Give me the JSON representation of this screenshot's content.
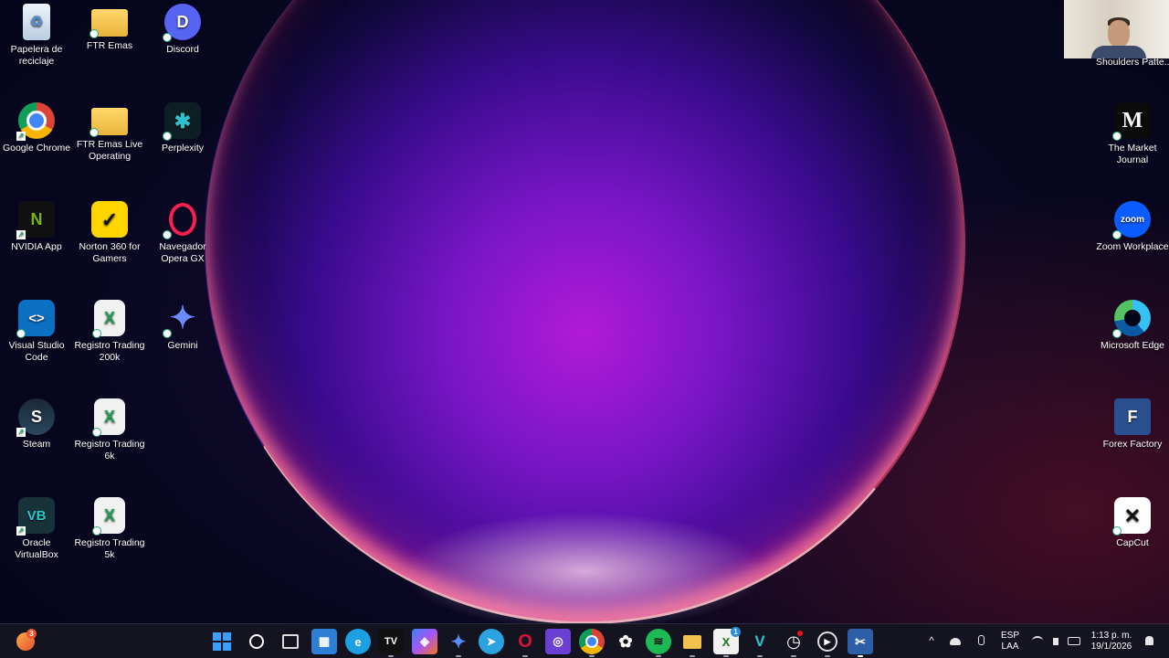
{
  "desktop": {
    "icons": [
      {
        "label": "Papelera de reciclaje",
        "icon": "recycle-bin-icon",
        "color": "#dfe9f5"
      },
      {
        "label": "FTR Emas",
        "icon": "folder-icon",
        "color": "#f2c14e"
      },
      {
        "label": "Discord",
        "icon": "discord-icon",
        "color": "#5865f2"
      },
      {
        "label": "Google Chrome",
        "icon": "chrome-icon",
        "color": "#4285f4"
      },
      {
        "label": "FTR Emas Live Operating",
        "icon": "folder-icon",
        "color": "#f2c14e"
      },
      {
        "label": "Perplexity",
        "icon": "perplexity-icon",
        "color": "#20808d"
      },
      {
        "label": "NVIDIA App",
        "icon": "nvidia-icon",
        "color": "#76b900"
      },
      {
        "label": "Norton 360 for Gamers",
        "icon": "norton-icon",
        "color": "#ffd500"
      },
      {
        "label": "Navegador Opera GX",
        "icon": "opera-gx-icon",
        "color": "#fa1e4e"
      },
      {
        "label": "Visual Studio Code",
        "icon": "vscode-icon",
        "color": "#2c8fe0"
      },
      {
        "label": "Registro Trading 200k",
        "icon": "excel-file-icon",
        "color": "#1f9d55"
      },
      {
        "label": "Gemini",
        "icon": "gemini-icon",
        "color": "#6a8cff"
      },
      {
        "label": "Steam",
        "icon": "steam-icon",
        "color": "#1b2838"
      },
      {
        "label": "Registro Trading 6k",
        "icon": "excel-file-icon",
        "color": "#1f9d55"
      },
      {
        "label": "Oracle VirtualBox",
        "icon": "virtualbox-icon",
        "color": "#2fa6a8"
      },
      {
        "label": "Registro Trading 5k",
        "icon": "excel-file-icon",
        "color": "#1f9d55"
      },
      {
        "label": "The Market Journal",
        "icon": "market-journal-icon",
        "color": "#111111"
      },
      {
        "label": "Zoom Workplace",
        "icon": "zoom-icon",
        "color": "#0b5cff"
      },
      {
        "label": "Microsoft Edge",
        "icon": "edge-icon",
        "color": "#1ba1e2"
      },
      {
        "label": "Forex Factory",
        "icon": "forex-factory-icon",
        "color": "#2a4f8f"
      },
      {
        "label": "CapCut",
        "icon": "capcut-icon",
        "color": "#ffffff"
      }
    ],
    "icon_texts": {
      "discord": "D",
      "zoom": "zoom",
      "journal": "M",
      "vscode": "<>",
      "norton": "✓",
      "steam": "S",
      "vbox": "VB",
      "capcut": "✕",
      "ff": "F",
      "excel": "X",
      "nvidia": "N",
      "perplexity": "✱",
      "gemini": "✦"
    }
  },
  "webcam": {
    "caption": "Shoulders Patte..."
  },
  "taskbar": {
    "apps": [
      {
        "name": "copilot-badge-icon",
        "text": "",
        "color": "#f47b20"
      },
      {
        "name": "windows-start-icon",
        "text": "⊞",
        "color": "#1e90ff"
      },
      {
        "name": "search-icon",
        "text": "⚲",
        "color": "#141420"
      },
      {
        "name": "task-view-icon",
        "text": "❐",
        "color": "#141420"
      },
      {
        "name": "microsoft-store-icon",
        "text": "▦",
        "color": "#2d7fd6"
      },
      {
        "name": "edge-icon",
        "text": "e",
        "color": "#1ba1e2"
      },
      {
        "name": "tradingview-icon",
        "text": "TV",
        "color": "#111111"
      },
      {
        "name": "copilot-icon",
        "text": "◈",
        "color": "#7f5cf0"
      },
      {
        "name": "gemini-icon",
        "text": "✦",
        "color": "#3d6bff"
      },
      {
        "name": "telegram-icon",
        "text": "➤",
        "color": "#2aa3e0"
      },
      {
        "name": "opera-gx-icon",
        "text": "O",
        "color": "#d4143a"
      },
      {
        "name": "photo-app-icon",
        "text": "◎",
        "color": "#6b3fd4"
      },
      {
        "name": "chrome-icon",
        "text": "◉",
        "color": "#db4437"
      },
      {
        "name": "chatgpt-icon",
        "text": "✿",
        "color": "#141420"
      },
      {
        "name": "spotify-icon",
        "text": "≋",
        "color": "#1db954"
      },
      {
        "name": "file-explorer-icon",
        "text": "▬",
        "color": "#f2c14e"
      },
      {
        "name": "xbox-icon",
        "text": "X",
        "color": "#107c10"
      },
      {
        "name": "vectr-icon",
        "text": "V",
        "color": "#2fa6a8"
      },
      {
        "name": "clock-app-icon",
        "text": "◷",
        "color": "#141420"
      },
      {
        "name": "media-player-icon",
        "text": "▶",
        "color": "#444455"
      },
      {
        "name": "snipping-tool-icon",
        "text": "✂",
        "color": "#3a7bd5"
      }
    ],
    "badges": {
      "copilot_count": "3",
      "xbox_count": "1"
    },
    "tray": {
      "chevron": "^",
      "language_line1": "ESP",
      "language_line2": "LAA",
      "time": "1:13 p. m.",
      "date": "19/1/2026"
    }
  }
}
